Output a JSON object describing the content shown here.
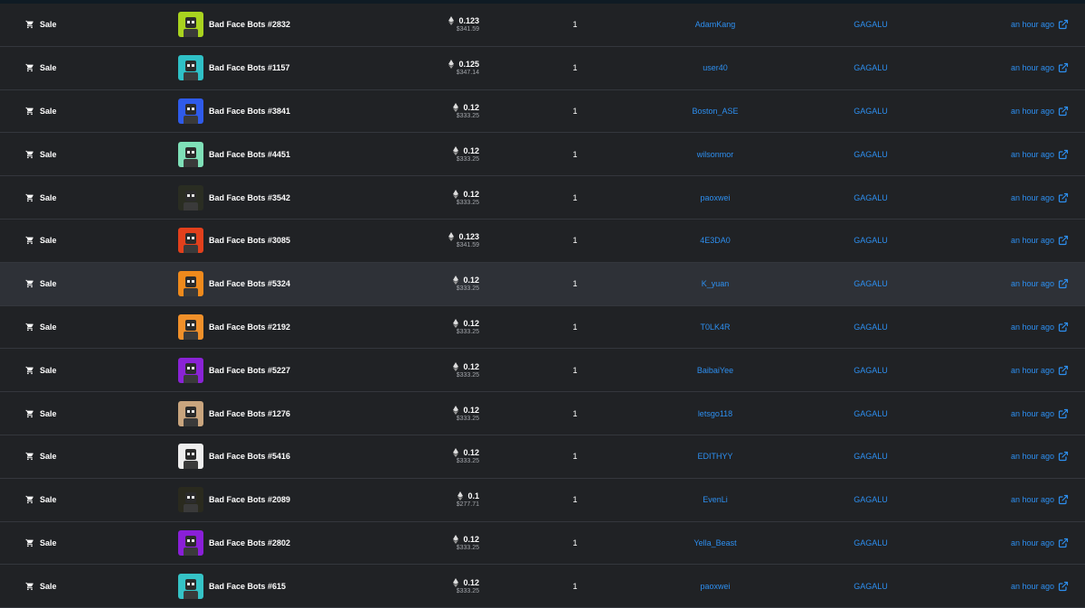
{
  "colors": {
    "background": "#202225",
    "row_highlight": "#2e3137",
    "link": "#2d8ff0",
    "muted": "#a3a6ab"
  },
  "icons": {
    "event": "cart-icon",
    "price": "eth-icon",
    "link": "external-link-icon"
  },
  "rows": [
    {
      "event": "Sale",
      "item": "Bad Face Bots #2832",
      "price": "0.123",
      "usd": "$341.59",
      "qty": "1",
      "from": "AdamKang",
      "to": "GAGALU",
      "time": "an hour ago",
      "thumb": "#a9d31f"
    },
    {
      "event": "Sale",
      "item": "Bad Face Bots #1157",
      "price": "0.125",
      "usd": "$347.14",
      "qty": "1",
      "from": "user40",
      "to": "GAGALU",
      "time": "an hour ago",
      "thumb": "#2fc0c6"
    },
    {
      "event": "Sale",
      "item": "Bad Face Bots #3841",
      "price": "0.12",
      "usd": "$333.25",
      "qty": "1",
      "from": "Boston_ASE",
      "to": "GAGALU",
      "time": "an hour ago",
      "thumb": "#2f5bea"
    },
    {
      "event": "Sale",
      "item": "Bad Face Bots #4451",
      "price": "0.12",
      "usd": "$333.25",
      "qty": "1",
      "from": "wilsonmor",
      "to": "GAGALU",
      "time": "an hour ago",
      "thumb": "#7fe0b8"
    },
    {
      "event": "Sale",
      "item": "Bad Face Bots #3542",
      "price": "0.12",
      "usd": "$333.25",
      "qty": "1",
      "from": "paoxwei",
      "to": "GAGALU",
      "time": "an hour ago",
      "thumb": "#2a2d22"
    },
    {
      "event": "Sale",
      "item": "Bad Face Bots #3085",
      "price": "0.123",
      "usd": "$341.59",
      "qty": "1",
      "from": "4E3DA0",
      "to": "GAGALU",
      "time": "an hour ago",
      "thumb": "#e2401c"
    },
    {
      "event": "Sale",
      "item": "Bad Face Bots #5324",
      "price": "0.12",
      "usd": "$333.25",
      "qty": "1",
      "from": "K_yuan",
      "to": "GAGALU",
      "time": "an hour ago",
      "thumb": "#ef8a1c",
      "highlight": true
    },
    {
      "event": "Sale",
      "item": "Bad Face Bots #2192",
      "price": "0.12",
      "usd": "$333.25",
      "qty": "1",
      "from": "T0LK4R",
      "to": "GAGALU",
      "time": "an hour ago",
      "thumb": "#f0902a"
    },
    {
      "event": "Sale",
      "item": "Bad Face Bots #5227",
      "price": "0.12",
      "usd": "$333.25",
      "qty": "1",
      "from": "BaibaiYee",
      "to": "GAGALU",
      "time": "an hour ago",
      "thumb": "#8a23d6"
    },
    {
      "event": "Sale",
      "item": "Bad Face Bots #1276",
      "price": "0.12",
      "usd": "$333.25",
      "qty": "1",
      "from": "letsgo118",
      "to": "GAGALU",
      "time": "an hour ago",
      "thumb": "#c9a57e"
    },
    {
      "event": "Sale",
      "item": "Bad Face Bots #5416",
      "price": "0.12",
      "usd": "$333.25",
      "qty": "1",
      "from": "EDITHYY",
      "to": "GAGALU",
      "time": "an hour ago",
      "thumb": "#eeeeee"
    },
    {
      "event": "Sale",
      "item": "Bad Face Bots #2089",
      "price": "0.1",
      "usd": "$277.71",
      "qty": "1",
      "from": "EvenLi",
      "to": "GAGALU",
      "time": "an hour ago",
      "thumb": "#2a2a1e"
    },
    {
      "event": "Sale",
      "item": "Bad Face Bots #2802",
      "price": "0.12",
      "usd": "$333.25",
      "qty": "1",
      "from": "Yella_Beast",
      "to": "GAGALU",
      "time": "an hour ago",
      "thumb": "#8a1fd8"
    },
    {
      "event": "Sale",
      "item": "Bad Face Bots #615",
      "price": "0.12",
      "usd": "$333.25",
      "qty": "1",
      "from": "paoxwei",
      "to": "GAGALU",
      "time": "an hour ago",
      "thumb": "#35c3c6"
    }
  ]
}
